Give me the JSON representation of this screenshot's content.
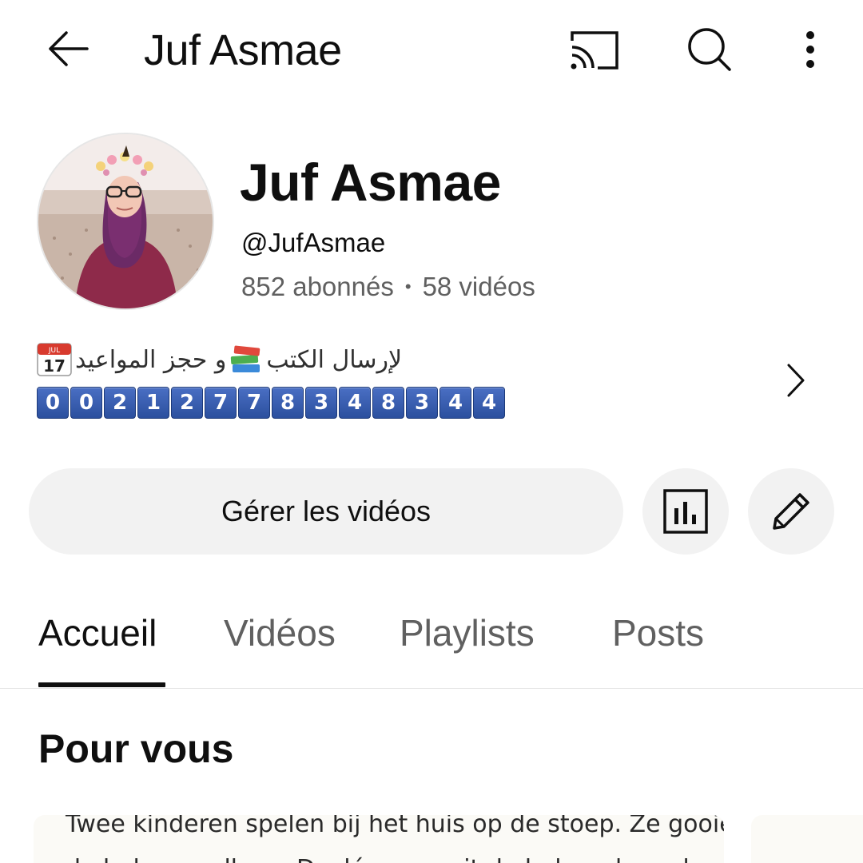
{
  "topbar": {
    "title": "Juf Asmae",
    "icons": [
      "back-arrow-icon",
      "cast-icon",
      "search-icon",
      "more-vert-icon"
    ]
  },
  "channel": {
    "name": "Juf Asmae",
    "handle": "@JufAsmae",
    "subscribers": "852 abonnés",
    "separator": "•",
    "videos": "58 vidéos",
    "avatar_icon": "channel-avatar-photo"
  },
  "description": {
    "line1_text": "لإرسال الكتب",
    "line1_connector": "و حجز المواعيد",
    "calendar_month": "JUL",
    "calendar_day": "17",
    "phone_digits": [
      "0",
      "0",
      "2",
      "1",
      "2",
      "7",
      "7",
      "8",
      "3",
      "4",
      "8",
      "3",
      "4",
      "4"
    ]
  },
  "actions": {
    "manage_label": "Gérer les vidéos",
    "analytics_icon": "analytics-icon",
    "edit_icon": "pencil-icon"
  },
  "tabs": [
    {
      "label": "Accueil",
      "active": true
    },
    {
      "label": "Vidéos",
      "active": false
    },
    {
      "label": "Playlists",
      "active": false
    },
    {
      "label": "Posts",
      "active": false
    }
  ],
  "section": {
    "title": "Pour vous"
  },
  "card": {
    "line1": "Twee kinderen spelen bij het huis op de stoep. Ze gooien een",
    "line2": "de bal naar elkaar. Dyaléa mag uit de bal en de andere mag het de bal"
  },
  "colors": {
    "text_primary": "#0f0f0f",
    "text_secondary": "#606060",
    "button_bg": "#f2f2f2",
    "digit_key_blue": "#2b4f9e"
  }
}
